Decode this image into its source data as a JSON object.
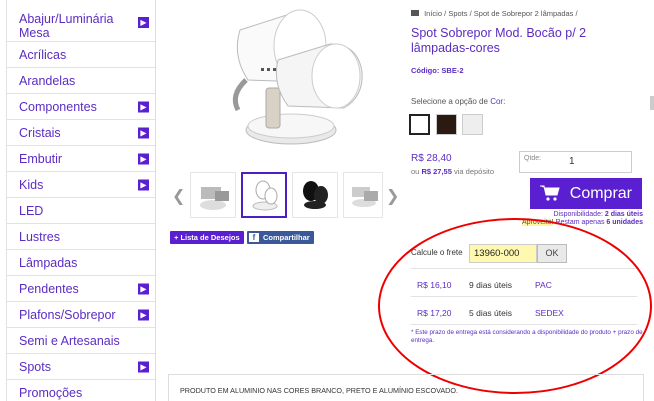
{
  "sidebar": {
    "items": [
      {
        "label": "Abajur/Luminária Mesa",
        "has_arrow": true
      },
      {
        "label": "Acrílicas",
        "has_arrow": false
      },
      {
        "label": "Arandelas",
        "has_arrow": false
      },
      {
        "label": "Componentes",
        "has_arrow": true
      },
      {
        "label": "Cristais",
        "has_arrow": true
      },
      {
        "label": "Embutir",
        "has_arrow": true
      },
      {
        "label": "Kids",
        "has_arrow": true
      },
      {
        "label": "LED",
        "has_arrow": false
      },
      {
        "label": "Lustres",
        "has_arrow": false
      },
      {
        "label": "Lâmpadas",
        "has_arrow": false
      },
      {
        "label": "Pendentes",
        "has_arrow": true
      },
      {
        "label": "Plafons/Sobrepor",
        "has_arrow": true
      },
      {
        "label": "Semi e Artesanais",
        "has_arrow": false
      },
      {
        "label": "Spots",
        "has_arrow": true
      },
      {
        "label": "Promoções",
        "has_arrow": false
      }
    ],
    "arrow_glyph": "▶"
  },
  "breadcrumb": {
    "items": [
      "Início",
      "Spots",
      "Spot de Sobrepor 2 lâmpadas"
    ],
    "separator": "/"
  },
  "product": {
    "title": "Spot Sobrepor Mod. Bocão p/ 2 lâmpadas-cores",
    "code_label": "Código:",
    "code_value": "SBE-2",
    "option_label": "Selecione a opção de",
    "option_name": "Cor:",
    "colors": [
      "#ffffff",
      "#2a1a12",
      "#eeeeee"
    ],
    "price": "R$ 28,40",
    "deposit_prefix": "ou",
    "deposit_price": "R$ 27,55",
    "deposit_suffix": "via depósito",
    "qty_placeholder": "Qtde:",
    "qty_value": "1",
    "buy_label": "Comprar",
    "availability_label": "Disponibilidade:",
    "availability_value": "2 dias úteis",
    "stock_hint": "Aproveite!",
    "stock_text": "Restam apenas",
    "stock_count": "6 unidades"
  },
  "actions": {
    "wishlist_label": "+ Lista de Desejos",
    "share_label": "Compartilhar",
    "fb_glyph": "f"
  },
  "shipping": {
    "label": "Calcule o frete",
    "cep_value": "13960-000",
    "ok_label": "OK",
    "rows": [
      {
        "price": "R$ 16,10",
        "days": "9 dias úteis",
        "service": "PAC"
      },
      {
        "price": "R$ 17,20",
        "days": "5 dias úteis",
        "service": "SEDEX"
      }
    ],
    "note": "* Este prazo de entrega está considerando a disponibilidade do produto + prazo de entrega."
  },
  "gallery": {
    "prev": "❮",
    "next": "❯",
    "selected_index": 1
  },
  "description": {
    "text": "PRODUTO EM ALUMINIO NAS CORES BRANCO, PRETO E ALUMÍNIO ESCOVADO."
  },
  "annotation_color": "#e00000",
  "accent_color": "#5a1fd0"
}
